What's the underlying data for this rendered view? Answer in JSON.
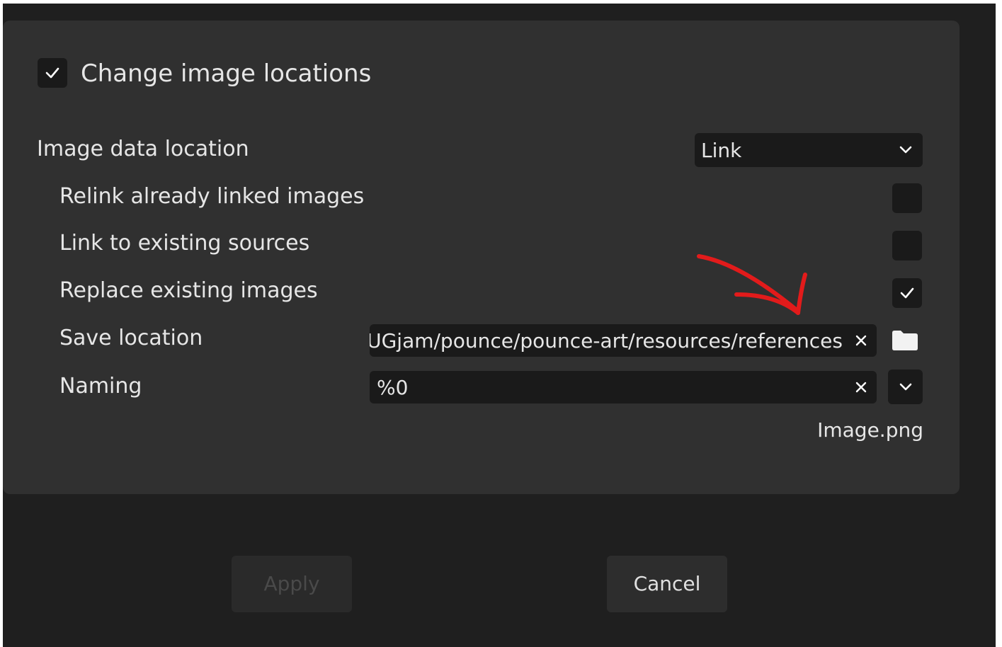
{
  "header": {
    "checkbox_checked": true,
    "label": "Change image locations"
  },
  "rows": {
    "image_data_location": {
      "label": "Image data location",
      "value": "Link"
    },
    "relink": {
      "label": "Relink already linked images",
      "checked": false
    },
    "link_existing": {
      "label": "Link to existing sources",
      "checked": false
    },
    "replace_existing": {
      "label": "Replace existing images",
      "checked": true
    },
    "save_location": {
      "label": "Save location",
      "value": "/BUGjam/pounce/pounce-art/resources/references"
    },
    "naming": {
      "label": "Naming",
      "value": "%0"
    }
  },
  "preview": "Image.png",
  "buttons": {
    "apply": "Apply",
    "cancel": "Cancel"
  },
  "annotation": {
    "color": "#e21b1b"
  },
  "icons": {
    "check": "check-icon",
    "chevron": "chevron-down-icon",
    "clear": "close-icon",
    "folder": "folder-icon"
  }
}
